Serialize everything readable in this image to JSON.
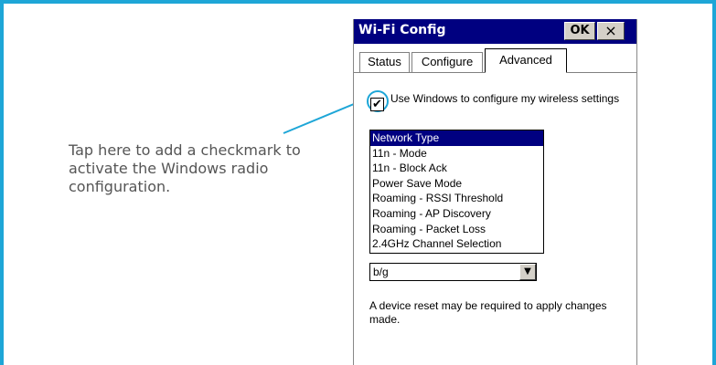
{
  "callout": {
    "text": "Tap here to add a checkmark to activate the Windows radio configuration."
  },
  "window": {
    "title": "Wi-Fi Config",
    "ok_label": "OK",
    "close_label": "×"
  },
  "tabs": [
    {
      "label": "Status",
      "active": false
    },
    {
      "label": "Configure",
      "active": false
    },
    {
      "label": "Advanced",
      "active": true
    }
  ],
  "checkbox": {
    "label": "Use Windows to configure my wireless settings",
    "checked": true,
    "mark": "✔"
  },
  "settings_list": {
    "items": [
      "Network Type",
      "11n - Mode",
      "11n - Block Ack",
      "Power Save Mode",
      "Roaming - RSSI Threshold",
      "Roaming - AP Discovery",
      "Roaming - Packet Loss",
      "2.4GHz Channel Selection"
    ],
    "selected_index": 0
  },
  "dropdown": {
    "value": "b/g",
    "arrow": "▼"
  },
  "note": "A device reset may be required to apply changes made.",
  "colors": {
    "accent": "#1ea6d7",
    "titlebar": "#000080"
  }
}
